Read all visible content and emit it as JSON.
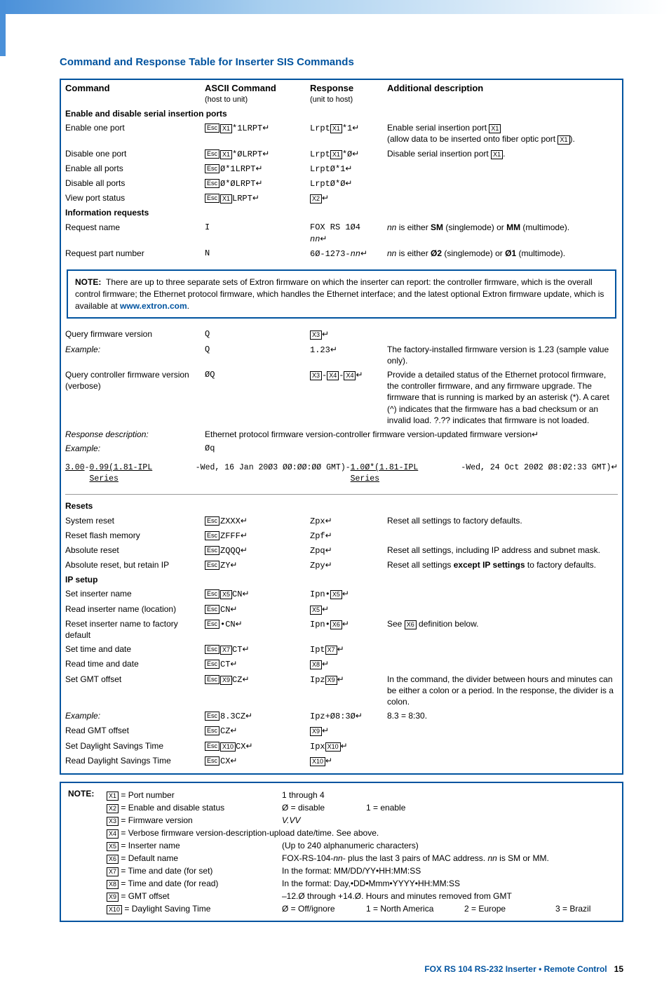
{
  "title": "Command and Response Table for Inserter SIS Commands",
  "th": {
    "c1": "Command",
    "c2": "ASCII Command",
    "c2s": "(host to unit)",
    "c3": "Response",
    "c3s": "(unit to host)",
    "c4": "Additional description"
  },
  "s1": "Enable and disable serial insertion ports",
  "r1": {
    "cmd": "Enable one port",
    "a1": "*1LRPT",
    "r1": "Lrpt",
    "r2": "*1",
    "d1": "Enable serial insertion port ",
    "d2": "(allow data to be inserted onto fiber optic port ",
    "d3": ")."
  },
  "r2": {
    "cmd": "Disable one port",
    "a1": "*ØLRPT",
    "r1": "Lrpt",
    "r2": "*Ø",
    "d1": "Disable serial insertion port ",
    "d2": "."
  },
  "r3": {
    "cmd": "Enable all ports",
    "a1": "Ø*1LRPT",
    "r1": "LrptØ*1"
  },
  "r4": {
    "cmd": "Disable all ports",
    "a1": "Ø*ØLRPT",
    "r1": "LrptØ*Ø"
  },
  "r5": {
    "cmd": "View port status",
    "a1": "LRPT"
  },
  "s2": "Information requests",
  "r6": {
    "cmd": "Request name",
    "a": "I",
    "r": "FOX RS 1Ø4 ",
    "ri": "nn",
    "d1": "nn",
    "d2": " is either ",
    "d3": "SM",
    "d4": " (singlemode) or ",
    "d5": "MM",
    "d6": " (multimode)."
  },
  "r7": {
    "cmd": "Request part number",
    "a": "N",
    "r": "6Ø-1273-",
    "ri": "nn",
    "d1": "nn",
    "d2": " is either ",
    "d3": "Ø2",
    "d4": " (singlemode) or ",
    "d5": "Ø1",
    "d6": " (multimode)."
  },
  "note1": {
    "lbl": "NOTE:",
    "t1": "There are up to three separate sets of Extron firmware on which the inserter can report: the controller firmware, which is the overall control firmware; the Ethernet protocol firmware, which handles the Ethernet interface; and the latest optional Extron firmware update, which is available at ",
    "link": "www.extron.com",
    "t2": "."
  },
  "r8": {
    "cmd": "Query firmware version",
    "a": "Q"
  },
  "r8e": {
    "cmd": "Example:",
    "a": "Q",
    "r": "1.23",
    "d": "The factory-installed firmware version is 1.23 (sample value only)."
  },
  "r9": {
    "cmd": "Query controller firmware version (verbose)",
    "a": "ØQ",
    "d": "Provide a detailed status of the Ethernet protocol firmware, the controller firmware, and any firmware upgrade. The firmware that is running is marked by an asterisk (*). A caret (^) indicates that the firmware has a bad checksum or an invalid load. ?.?? indicates that firmware is not loaded."
  },
  "r9d": {
    "cmd": "Response description:",
    "d": "Ethernet protocol firmware version-controller firmware version-updated firmware version"
  },
  "r9e": {
    "cmd": "Example:",
    "a": "Øq"
  },
  "ex": {
    "p1": "3.00",
    "p2": "-",
    "p3": "0.99(1.81-IPL Series",
    "p4": "   -Wed, 16 Jan 20Ø3 ØØ:ØØ:ØØ GMT)",
    "p5": "-",
    "p6": "1.0Ø*(1.81-IPL Series",
    "p7": "   -Wed, 24 Oct 20Ø2 Ø8:Ø2:33 GMT)"
  },
  "s3": "Resets",
  "r10": {
    "cmd": "System reset",
    "a": "ZXXX",
    "r": "Zpx",
    "d": "Reset all settings to factory defaults."
  },
  "r11": {
    "cmd": "Reset flash memory",
    "a": "ZFFF",
    "r": "Zpf"
  },
  "r12": {
    "cmd": "Absolute reset",
    "a": "ZQQQ",
    "r": "Zpq",
    "d": "Reset all settings, including IP address and subnet mask."
  },
  "r13": {
    "cmd": "Absolute reset, but retain IP",
    "a": "ZY",
    "r": "Zpy",
    "d1": "Reset all settings ",
    "d2": "except IP settings",
    "d3": " to factory defaults."
  },
  "s4": "IP setup",
  "r14": {
    "cmd": "Set inserter name",
    "a": "CN",
    "r": "Ipn•"
  },
  "r15": {
    "cmd": "Read inserter name (location)",
    "a": "CN"
  },
  "r16": {
    "cmd": "Reset inserter name to factory default",
    "a": "•CN",
    "r": "Ipn•",
    "d1": "See ",
    "d2": " definition below."
  },
  "r17": {
    "cmd": "Set time and date",
    "a": "CT",
    "r": "Ipt"
  },
  "r18": {
    "cmd": "Read time and date",
    "a": "CT"
  },
  "r19": {
    "cmd": "Set GMT offset",
    "a": "CZ",
    "r": "Ipz",
    "d": "In the command, the divider between hours and minutes can be either a colon or a period. In the response, the divider is a colon."
  },
  "r19e": {
    "cmd": "Example:",
    "a": "8.3CZ",
    "r": "Ipz+Ø8:3Ø",
    "d": "8.3 = 8:30."
  },
  "r20": {
    "cmd": "Read GMT offset",
    "a": "CZ"
  },
  "r21": {
    "cmd": "Set Daylight Savings Time",
    "a": "CX",
    "r": "Ipx"
  },
  "r22": {
    "cmd": "Read Daylight Savings Time",
    "a": "CX"
  },
  "legend": {
    "lbl": "NOTE:",
    "l1": {
      "k": "X1",
      "d": " = Port number",
      "v": "1 through 4"
    },
    "l2": {
      "k": "X2",
      "d": " = Enable and disable status",
      "v1": "Ø = disable",
      "v2": "1 = enable"
    },
    "l3": {
      "k": "X3",
      "d": " = Firmware version",
      "v": "V.VV"
    },
    "l4": {
      "k": "X4",
      "d": " = Verbose firmware version-description-upload date/time. See above."
    },
    "l5": {
      "k": "X5",
      "d": " = Inserter name",
      "v": "(Up to 240 alphanumeric characters)"
    },
    "l6": {
      "k": "X6",
      "d": " = Default name",
      "v1": "FOX-RS-104-",
      "v2": "nn",
      "v3": "- plus the last 3 pairs of MAC address. ",
      "v4": "nn",
      "v5": " is SM or MM."
    },
    "l7": {
      "k": "X7",
      "d": " = Time and date (for set)",
      "v": "In the format: MM/DD/YY•HH:MM:SS"
    },
    "l8": {
      "k": "X8",
      "d": " = Time and date (for read)",
      "v": "In the format: Day,•DD•Mmm•YYYY•HH:MM:SS"
    },
    "l9": {
      "k": "X9",
      "d": " = GMT offset",
      "v": "–12.Ø through +14.Ø.  Hours and minutes removed from GMT"
    },
    "l10": {
      "k": "X10",
      "d": " = Daylight Saving Time",
      "v1": "Ø = Off/ignore",
      "v2": "1 = North America",
      "v3": "2 = Europe",
      "v4": "3 = Brazil"
    }
  },
  "footer": {
    "t": "FOX RS 104 RS-232 Inserter • Remote Control",
    "n": "15"
  }
}
